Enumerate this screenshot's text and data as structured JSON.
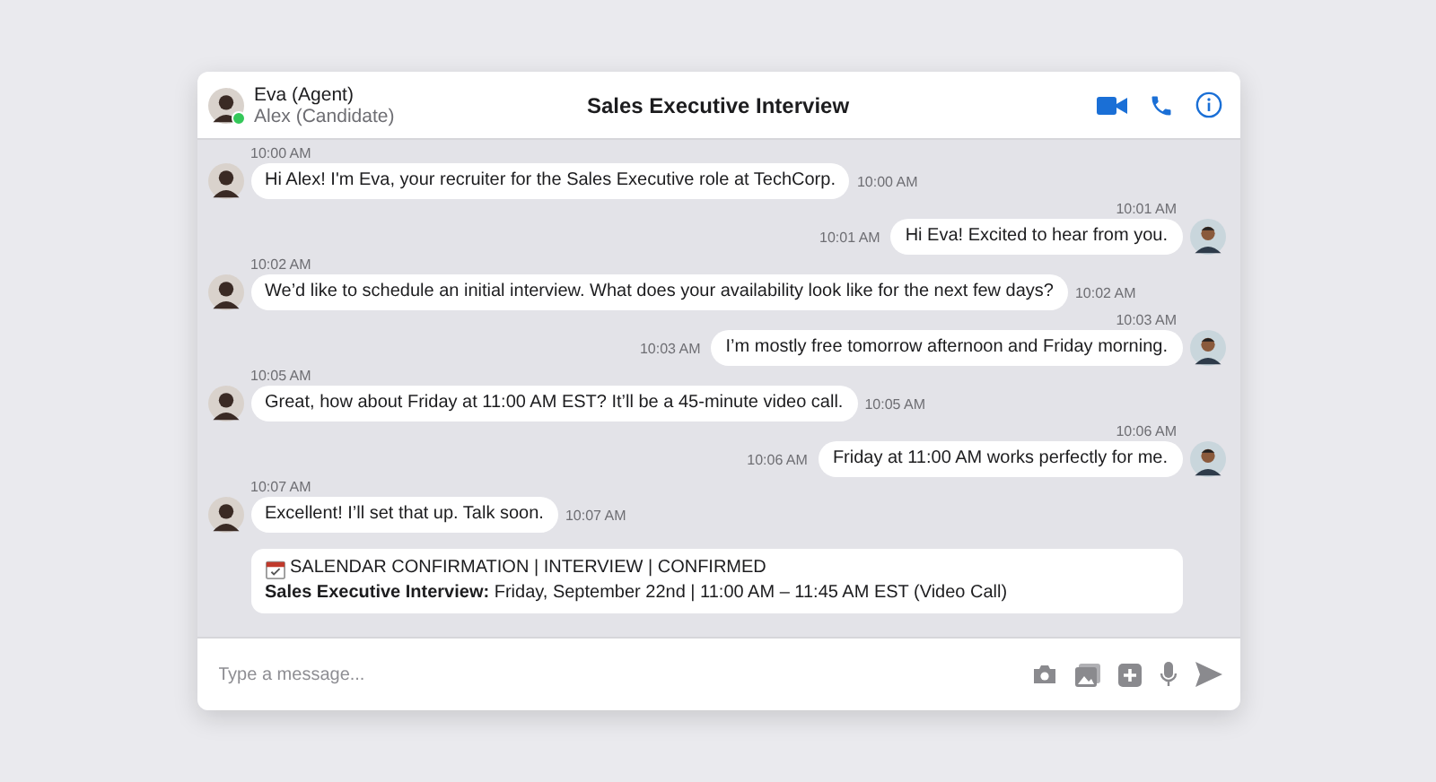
{
  "header": {
    "agent": "Eva (Agent)",
    "online": true,
    "candidate": "Alex (Candidate)",
    "title": "Sales Executive Interview"
  },
  "messages": [
    {
      "kind": "agent",
      "time": "10:00 AM",
      "side_time": "10:00 AM",
      "text": "Hi Alex! I'm Eva, your recruiter for the Sales Executive role at TechCorp."
    },
    {
      "kind": "candidate",
      "time": "10:01 AM",
      "side_time": "10:01 AM",
      "text": "Hi Eva! Excited to hear from you."
    },
    {
      "kind": "agent",
      "time": "10:02 AM",
      "side_time": "10:02 AM",
      "text": "We’d like to schedule an initial interview. What does your availability look like for the next few days?"
    },
    {
      "kind": "candidate",
      "time": "10:03 AM",
      "side_time": "10:03 AM",
      "text": "I’m mostly free tomorrow afternoon and Friday morning."
    },
    {
      "kind": "agent",
      "time": "10:05 AM",
      "side_time": "10:05 AM",
      "text": "Great, how about Friday at 11:00 AM EST? It’ll be a 45-minute video call."
    },
    {
      "kind": "candidate",
      "time": "10:06 AM",
      "side_time": "10:06 AM",
      "text": "Friday at 11:00 AM works perfectly for me."
    },
    {
      "kind": "agent",
      "time": "10:07 AM",
      "side_time": "10:07 AM",
      "text": "Excellent! I’ll set that up. Talk soon."
    },
    {
      "kind": "card",
      "title": "SALENDAR CONFIRMATION | INTERVIEW | CONFIRMED",
      "text": "**Sales Executive Interview:** Friday, September 22nd | 11:00 AM – 11:45 AM EST (Video Call)"
    }
  ],
  "composer": {
    "placeholder": "Type a message..."
  }
}
